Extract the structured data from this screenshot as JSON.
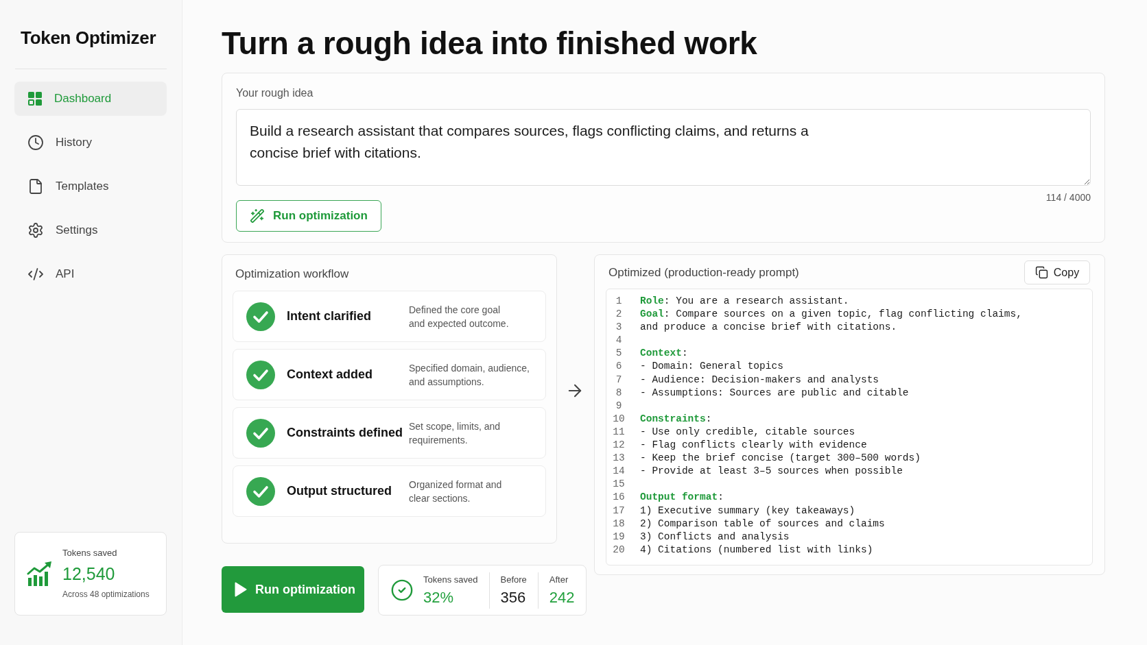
{
  "sidebar": {
    "title": "Token Optimizer",
    "nav_items": [
      {
        "label": "Dashboard",
        "selected": true
      },
      {
        "label": "History",
        "selected": false
      },
      {
        "label": "Templates",
        "selected": false
      },
      {
        "label": "Settings",
        "selected": false
      },
      {
        "label": "API",
        "selected": false
      }
    ],
    "stats_card": {
      "label": "Tokens saved",
      "value": "12,540",
      "caption": "Across 48 optimizations"
    }
  },
  "page_title": "Turn a rough idea into finished work",
  "idea_card": {
    "label": "Your rough idea",
    "value": "Build a research assistant that compares sources, flags conflicting claims, and returns a concise brief with citations.",
    "counter": "114 / 4000",
    "button": "Run optimization"
  },
  "workflow": {
    "title": "Optimization workflow",
    "steps": [
      {
        "title": "Intent clarified",
        "description": "Defined the core goal\nand expected outcome.",
        "done": true
      },
      {
        "title": "Context added",
        "description": "Specified domain, audience,\nand assumptions.",
        "done": true
      },
      {
        "title": "Constraints defined",
        "description": "Set scope, limits, and\nrequirements.",
        "done": true
      },
      {
        "title": "Output structured",
        "description": "Organized format and\nclear sections.",
        "done": true
      }
    ]
  },
  "output": {
    "title": "Optimized (production-ready prompt)",
    "copy_button": "Copy",
    "lines": [
      {
        "number": "1",
        "keyword": "Role",
        "text": ": You are a research assistant."
      },
      {
        "number": "2",
        "keyword": "Goal",
        "text": ": Compare sources on a given topic, flag conflicting claims,"
      },
      {
        "number": "3",
        "text": "and produce a concise brief with citations."
      },
      {
        "number": "4"
      },
      {
        "number": "5",
        "keyword": "Context",
        "text": ":"
      },
      {
        "number": "6",
        "text": "- Domain: General topics"
      },
      {
        "number": "7",
        "text": "- Audience: Decision-makers and analysts"
      },
      {
        "number": "8",
        "text": "- Assumptions: Sources are public and citable"
      },
      {
        "number": "9"
      },
      {
        "number": "10",
        "keyword": "Constraints",
        "text": ":"
      },
      {
        "number": "11",
        "text": "- Use only credible, citable sources"
      },
      {
        "number": "12",
        "text": "- Flag conflicts clearly with evidence"
      },
      {
        "number": "13",
        "text": "- Keep the brief concise (target 300–500 words)"
      },
      {
        "number": "14",
        "text": "- Provide at least 3–5 sources when possible"
      },
      {
        "number": "15"
      },
      {
        "number": "16",
        "keyword": "Output format",
        "text": ":"
      },
      {
        "number": "17",
        "text": "1) Executive summary (key takeaways)"
      },
      {
        "number": "18",
        "text": "2) Comparison table of sources and claims"
      },
      {
        "number": "19",
        "text": "3) Conflicts and analysis"
      },
      {
        "number": "20",
        "text": "4) Citations (numbered list with links)"
      }
    ]
  },
  "run_button": "Run optimization",
  "results": {
    "stats": [
      {
        "label": "Tokens saved",
        "value": "32%",
        "color": "#22a03d"
      },
      {
        "label": "Before",
        "value": "356",
        "color": "#1a1a1a"
      },
      {
        "label": "After",
        "value": "242",
        "color": "#22a03d"
      }
    ]
  }
}
